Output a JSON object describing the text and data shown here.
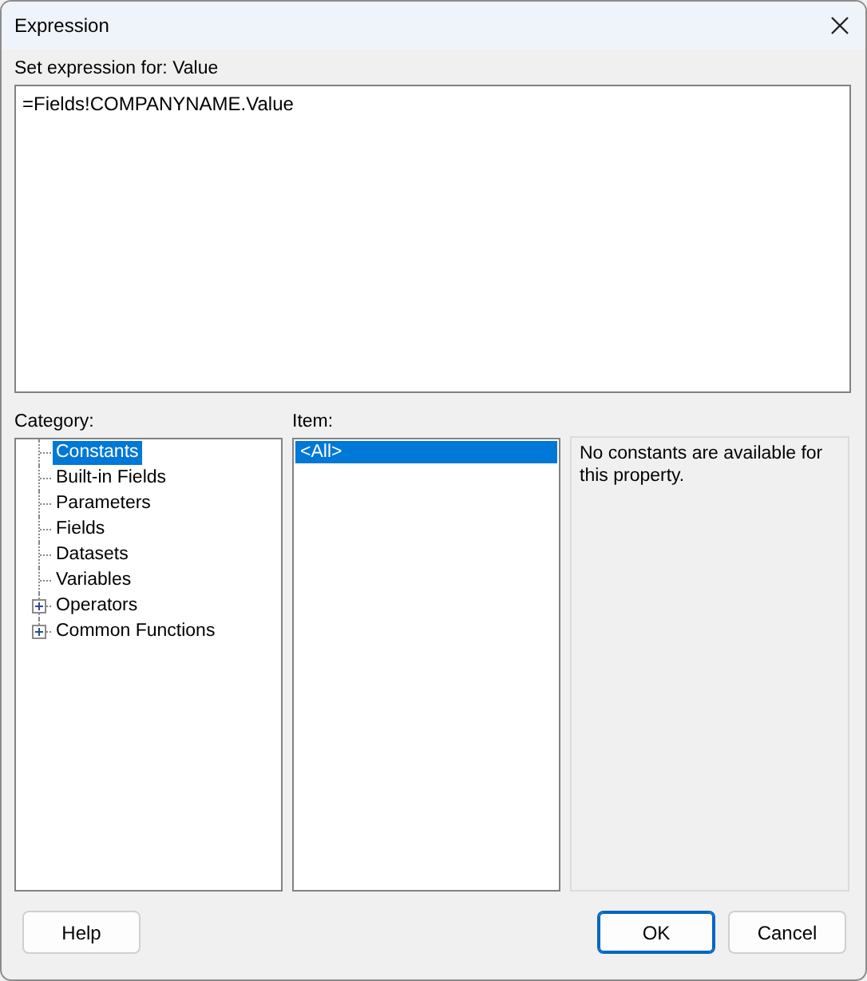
{
  "window": {
    "title": "Expression"
  },
  "expression": {
    "label": "Set expression for: Value",
    "value": "=Fields!COMPANYNAME.Value"
  },
  "category": {
    "label": "Category:",
    "items": [
      {
        "label": "Constants",
        "selected": true,
        "kind": "leaf"
      },
      {
        "label": "Built-in Fields",
        "selected": false,
        "kind": "leaf"
      },
      {
        "label": "Parameters",
        "selected": false,
        "kind": "leaf"
      },
      {
        "label": "Fields",
        "selected": false,
        "kind": "leaf"
      },
      {
        "label": "Datasets",
        "selected": false,
        "kind": "leaf"
      },
      {
        "label": "Variables",
        "selected": false,
        "kind": "leaf"
      },
      {
        "label": "Operators",
        "selected": false,
        "kind": "group",
        "expanded": false
      },
      {
        "label": "Common Functions",
        "selected": false,
        "kind": "group",
        "expanded": false
      }
    ]
  },
  "item": {
    "label": "Item:",
    "items": [
      {
        "label": "<All>",
        "selected": true
      }
    ]
  },
  "description": "No constants are available for this property.",
  "buttons": [
    {
      "label": "Help",
      "default": false
    },
    {
      "label": "OK",
      "default": true
    },
    {
      "label": "Cancel",
      "default": false
    }
  ]
}
